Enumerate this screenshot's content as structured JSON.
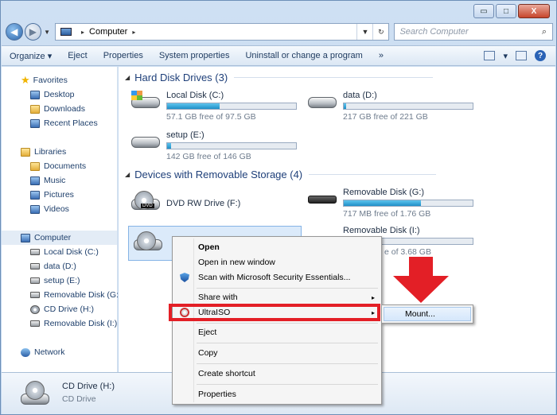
{
  "caption": {
    "minimize": "▭",
    "maximize": "□",
    "close": "X"
  },
  "address": {
    "root": "Computer",
    "sep": "▸",
    "sep2": "▸",
    "dropdown": "▼",
    "refresh": "↻"
  },
  "search": {
    "placeholder": "Search Computer",
    "icon": "⌕"
  },
  "nav": {
    "back": "◀",
    "forward": "▶",
    "history": "▼"
  },
  "toolbar": {
    "organize": "Organize ▾",
    "eject": "Eject",
    "properties": "Properties",
    "system_properties": "System properties",
    "uninstall": "Uninstall or change a program",
    "more": "»",
    "view_arrow": "▾",
    "help": "?"
  },
  "sidebar": {
    "favorites": "Favorites",
    "desktop": "Desktop",
    "downloads": "Downloads",
    "recent": "Recent Places",
    "libraries": "Libraries",
    "documents": "Documents",
    "music": "Music",
    "pictures": "Pictures",
    "videos": "Videos",
    "computer": "Computer",
    "local_c": "Local Disk (C:)",
    "data_d": "data (D:)",
    "setup_e": "setup (E:)",
    "removable_g": "Removable Disk (G:)",
    "cd_h": "CD Drive (H:)",
    "removable_i": "Removable Disk (I:)",
    "network": "Network"
  },
  "groups": {
    "hdd": "Hard Disk Drives (3)",
    "removable": "Devices with Removable Storage (4)",
    "tri": "◢"
  },
  "drives": {
    "c": {
      "name": "Local Disk (C:)",
      "free": "57.1 GB free of 97.5 GB",
      "used_fraction": 0.41
    },
    "d": {
      "name": "data (D:)",
      "free": "217 GB free of 221 GB",
      "used_fraction": 0.02
    },
    "e": {
      "name": "setup (E:)",
      "free": "142 GB free of 146 GB",
      "used_fraction": 0.03
    },
    "f": {
      "name": "DVD RW Drive (F:)"
    },
    "g": {
      "name": "Removable Disk (G:)",
      "free": "717 MB free of 1.76 GB",
      "used_fraction": 0.6
    },
    "i": {
      "name": "Removable Disk (I:)",
      "free": "e of 3.68 GB",
      "used_fraction": 0.05
    },
    "dvd_tag": "DVD"
  },
  "context_menu": {
    "open": "Open",
    "open_new": "Open in new window",
    "scan": "Scan with Microsoft Security Essentials...",
    "share": "Share with",
    "ultraiso": "UltraISO",
    "eject": "Eject",
    "copy": "Copy",
    "shortcut": "Create shortcut",
    "properties": "Properties",
    "arrow": "▸"
  },
  "submenu": {
    "mount": "Mount..."
  },
  "details": {
    "name": "CD Drive (H:)",
    "type": "CD Drive"
  },
  "colors": {
    "highlight": "#e31f26",
    "bar": "#1f8fc7",
    "accent": "#1e3f79"
  }
}
